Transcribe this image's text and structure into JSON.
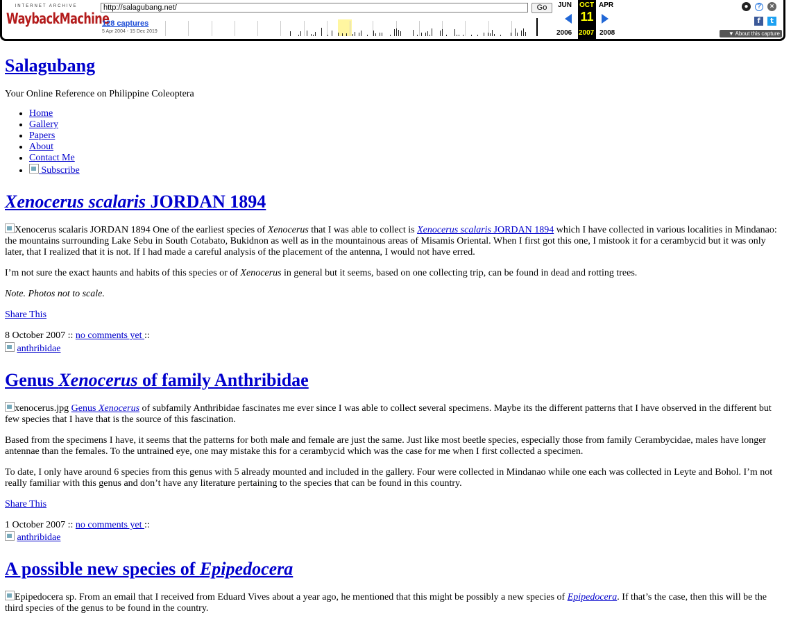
{
  "wayback": {
    "logo_top": "INTERNET ARCHIVE",
    "logo_main": "WaybackMachine",
    "url": "http://salagubang.net/",
    "go_label": "Go",
    "captures_label": "128 captures",
    "range": "5 Apr 2004 - 15 Dec 2019",
    "months": {
      "prev": "JUN",
      "current": "OCT",
      "next": "APR"
    },
    "day": "11",
    "years": {
      "prev": "2006",
      "current": "2007",
      "next": "2008"
    },
    "about_label": "▼ About this capture",
    "colors": {
      "accent": "#2167d6",
      "current": "#ffff00",
      "logo": "#b31b1b"
    }
  },
  "site": {
    "title": "Salagubang",
    "tagline": "Your Online Reference on Philippine Coleoptera",
    "nav": [
      "Home",
      "Gallery",
      "Papers",
      "About",
      "Contact Me",
      " Subscribe"
    ]
  },
  "posts": [
    {
      "title_italic": "Xenocerus scalaris",
      "title_rest": " JORDAN 1894",
      "img_alt": "Xenocerus scalaris JORDAN 1894",
      "p1_a": " One of the earliest species of ",
      "p1_i": "Xenocerus",
      "p1_b": " that I was able to collect is ",
      "p1_link_i": "Xenocerus scalaris",
      "p1_link_rest": " JORDAN 1894",
      "p1_c": " which I have collected in various localities in Mindanao: the mountains surrounding Lake Sebu in South Cotabato, Bukidnon as well as in the mountainous areas of Misamis Oriental. When I first got this one, I mistook it for a cerambycid but it was only later, that I realized that it is not. If I had made a careful analysis of the placement of the antenna, I would not have erred.",
      "p2_a": "I’m not sure the exact haunts and habits of this species or of ",
      "p2_i": "Xenocerus",
      "p2_b": " in general but it seems, based on one collecting trip, can be found in dead and rotting trees.",
      "p3": "Note. Photos not to scale.",
      "share": "Share This",
      "date": "8 October 2007 :: ",
      "comments": "no comments yet ",
      "after": "::",
      "tag": "anthribidae"
    },
    {
      "title_a": "Genus ",
      "title_italic": "Xenocerus",
      "title_rest": " of family Anthribidae",
      "img_alt": "xenocerus.jpg",
      "p1_link_a": "Genus ",
      "p1_link_i": "Xenocerus",
      "p1_a": " of subfamily Anthribidae fascinates me ever since I was able to collect several specimens. Maybe its the different patterns that I have observed in the different but few species that I have that is the source of this fascination.",
      "p2": "Based from the specimens I have, it seems that the patterns for both male and female are just the same. Just like most beetle species, especially those from family Cerambycidae, males have longer antennae than the females. To the untrained eye, one may mistake this for a cerambycid which was the case for me when I first collected a specimen.",
      "p3": "To date, I only have around 6 species from this genus with 5 already mounted and included in the gallery. Four were collected in Mindanao while one each was collected in Leyte and Bohol. I’m not really familiar with this genus and don’t have any literature pertaining to the species that can be found in this country.",
      "share": "Share This",
      "date": "1 October 2007 :: ",
      "comments": "no comments yet ",
      "after": "::",
      "tag": "anthribidae"
    },
    {
      "title_a": "A possible new species of ",
      "title_italic": "Epipedocera",
      "img_alt": "Epipedocera sp.",
      "p1_a": " From an email that I received from Eduard Vives about a year ago, he mentioned that this might be possibly a new species of ",
      "p1_link_i": "Epipedocera",
      "p1_b": ". If that’s the case, then this will be the third species of the genus to be found in the country."
    }
  ]
}
